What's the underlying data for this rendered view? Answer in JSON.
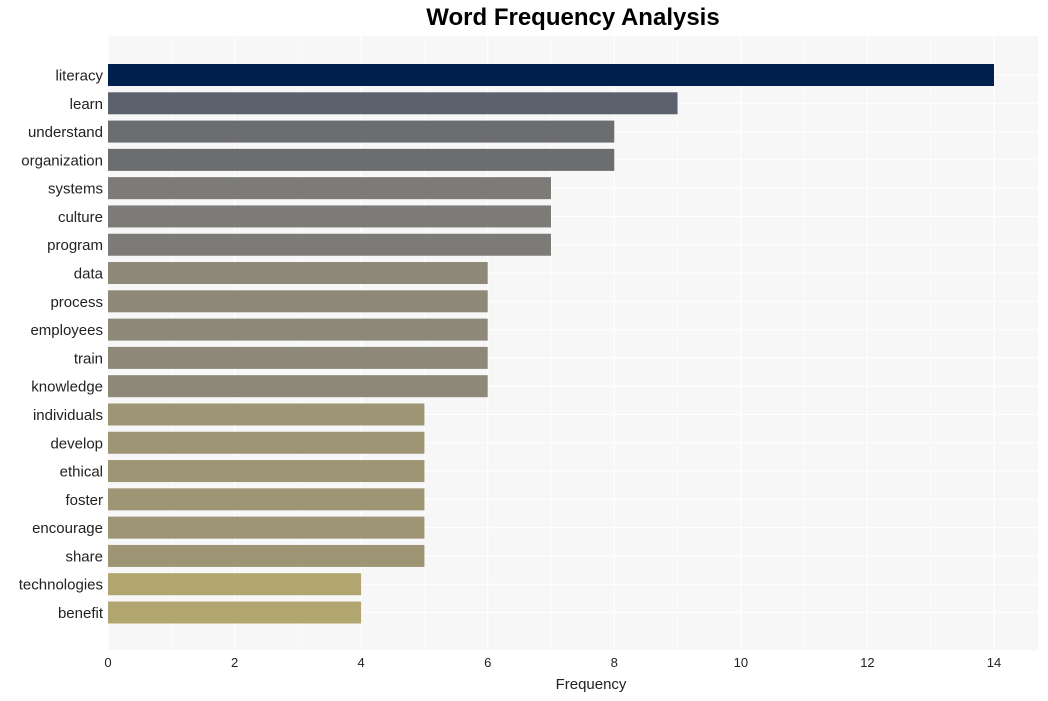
{
  "chart_data": {
    "type": "bar",
    "orientation": "horizontal",
    "title": "Word Frequency Analysis",
    "xlabel": "Frequency",
    "ylabel": "",
    "xlim": [
      0,
      14.7
    ],
    "xticks": [
      0,
      2,
      4,
      6,
      8,
      10,
      12,
      14
    ],
    "grid": true,
    "categories": [
      "literacy",
      "learn",
      "understand",
      "organization",
      "systems",
      "culture",
      "program",
      "data",
      "process",
      "employees",
      "train",
      "knowledge",
      "individuals",
      "develop",
      "ethical",
      "foster",
      "encourage",
      "share",
      "technologies",
      "benefit"
    ],
    "values": [
      14,
      9,
      8,
      8,
      7,
      7,
      7,
      6,
      6,
      6,
      6,
      6,
      5,
      5,
      5,
      5,
      5,
      5,
      4,
      4
    ],
    "colors": [
      "#00204e",
      "#5c616e",
      "#6c6d70",
      "#6c6d70",
      "#7c7b78",
      "#7c7b78",
      "#7c7b78",
      "#8d8878",
      "#8d8878",
      "#8d8878",
      "#8d8878",
      "#8d8878",
      "#9e9574",
      "#9e9574",
      "#9e9574",
      "#9e9574",
      "#9e9574",
      "#9e9574",
      "#b1a570",
      "#b1a570"
    ],
    "panel_background": "#f7f7f7",
    "grid_color": "#ffffff"
  }
}
